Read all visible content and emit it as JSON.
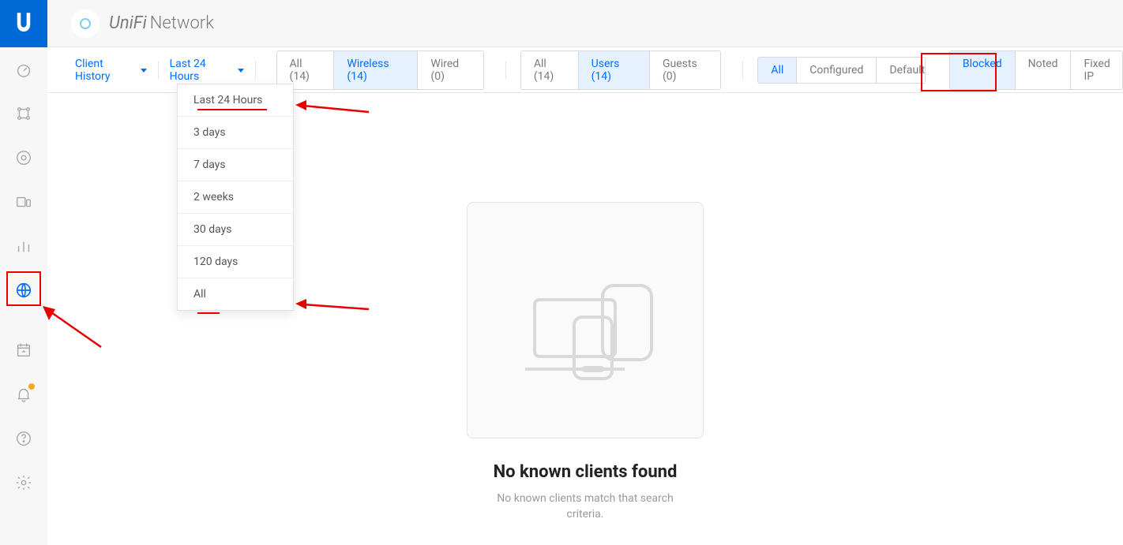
{
  "header": {
    "brand": "UniFi",
    "app_name": "Network"
  },
  "sidebar": {
    "items": [
      {
        "name": "dashboard-icon"
      },
      {
        "name": "topology-icon"
      },
      {
        "name": "radio-icon"
      },
      {
        "name": "devices-icon"
      },
      {
        "name": "statistics-icon"
      },
      {
        "name": "clients-icon"
      },
      {
        "name": "events-icon"
      },
      {
        "name": "alerts-icon"
      },
      {
        "name": "help-icon"
      },
      {
        "name": "settings-icon"
      }
    ]
  },
  "filters": {
    "client_history_label": "Client History",
    "time_range_label": "Last 24 Hours",
    "connection": {
      "all": "All (14)",
      "wireless": "Wireless (14)",
      "wired": "Wired (0)"
    },
    "type": {
      "all": "All (14)",
      "users": "Users (14)",
      "guests": "Guests (0)"
    },
    "config": {
      "all": "All",
      "configured": "Configured",
      "default": "Default"
    },
    "status": {
      "blocked": "Blocked",
      "noted": "Noted",
      "fixed_ip": "Fixed IP"
    }
  },
  "dropdown": {
    "items": [
      "Last 24 Hours",
      "3 days",
      "7 days",
      "2 weeks",
      "30 days",
      "120 days",
      "All"
    ]
  },
  "empty": {
    "title": "No known clients found",
    "subtitle": "No known clients match that search criteria."
  }
}
